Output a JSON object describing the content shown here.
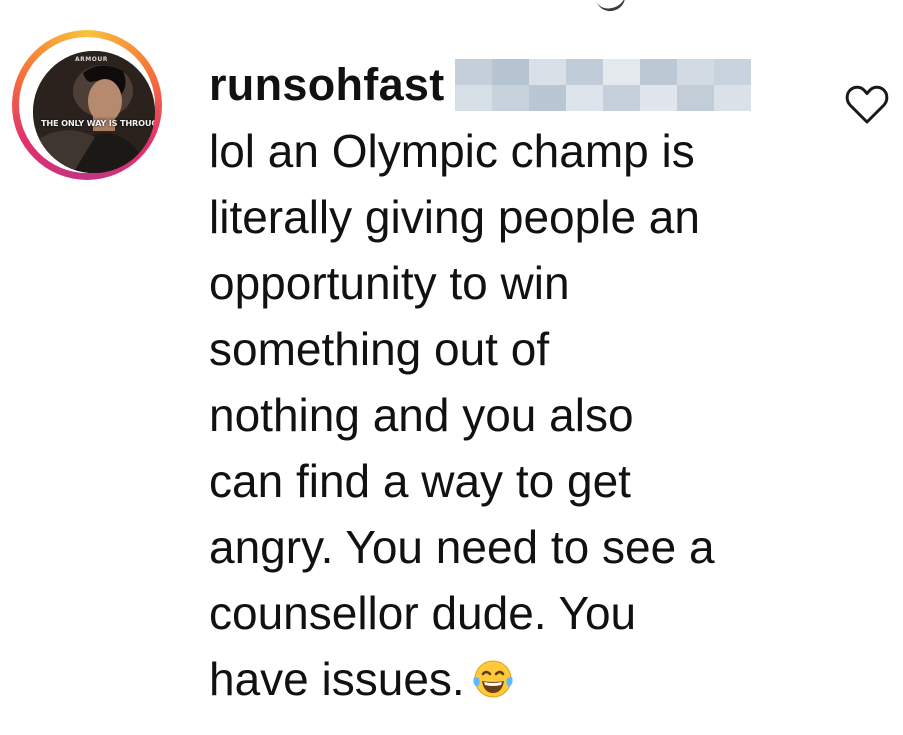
{
  "comment": {
    "username": "runsohfast",
    "avatar": {
      "caption": "THE ONLY WAY IS THROUGH.",
      "brand": "ARMOUR"
    },
    "lines": [
      "lol an Olympic champ is",
      "literally giving people an",
      "opportunity to win",
      "something out of",
      "nothing and you also",
      "can find a way to get",
      "angry. You need to see a",
      "counsellor dude. You",
      "have issues."
    ],
    "emoji": "tears-of-joy-emoji",
    "like_icon": "heart-outline-icon"
  },
  "colors": {
    "text": "#111111",
    "ring_start": "#f9c33d",
    "ring_mid": "#e1306c",
    "ring_end": "#c13584",
    "redaction_dark": "#b9c6d3",
    "redaction_light": "#dfe5ec"
  }
}
